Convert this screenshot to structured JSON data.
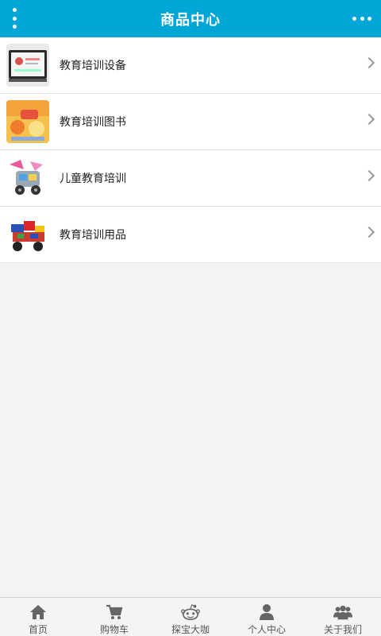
{
  "header": {
    "title": "商品中心"
  },
  "list": {
    "items": [
      {
        "label": "教育培训设备"
      },
      {
        "label": "教育培训图书"
      },
      {
        "label": "儿童教育培训"
      },
      {
        "label": "教育培训用品"
      }
    ]
  },
  "tabbar": {
    "tabs": [
      {
        "label": "首页",
        "icon": "home-icon"
      },
      {
        "label": "购物车",
        "icon": "cart-icon"
      },
      {
        "label": "探宝大咖",
        "icon": "reddit-alien-icon"
      },
      {
        "label": "个人中心",
        "icon": "user-icon"
      },
      {
        "label": "关于我们",
        "icon": "users-group-icon"
      }
    ]
  },
  "colors": {
    "header_bg": "#00a6d6",
    "page_bg": "#f3f3f3"
  }
}
